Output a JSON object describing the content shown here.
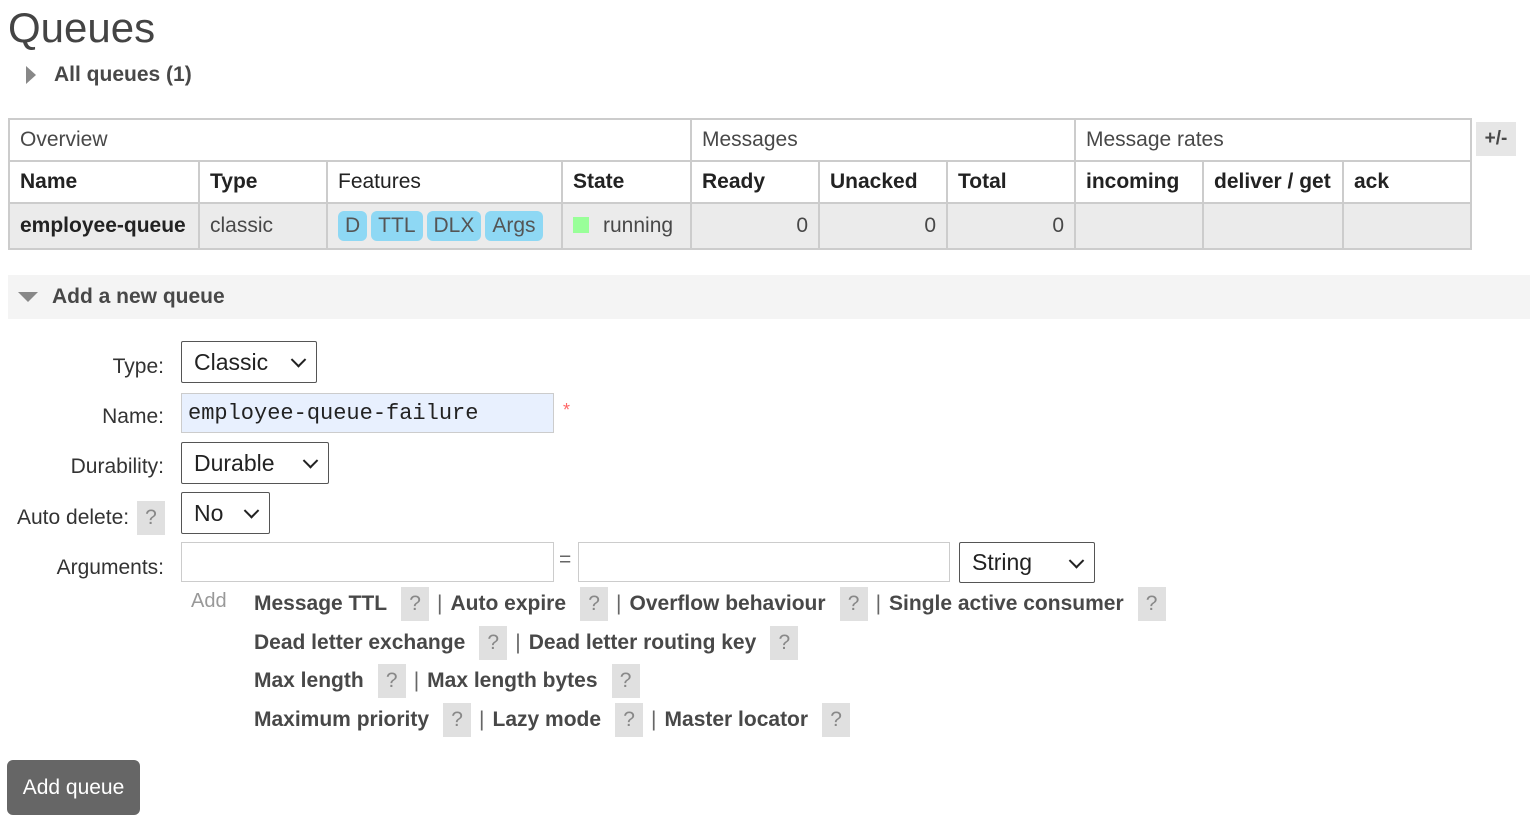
{
  "page": {
    "title": "Queues"
  },
  "all_queues": {
    "label": "All queues (1)"
  },
  "table": {
    "groups": [
      "Overview",
      "Messages",
      "Message rates"
    ],
    "plus_minus": "+/-",
    "headers": [
      "Name",
      "Type",
      "Features",
      "State",
      "Ready",
      "Unacked",
      "Total",
      "incoming",
      "deliver / get",
      "ack"
    ],
    "rows": [
      {
        "name": "employee-queue",
        "type": "classic",
        "features": [
          "D",
          "TTL",
          "DLX",
          "Args"
        ],
        "state": "running",
        "ready": "0",
        "unacked": "0",
        "total": "0",
        "incoming": "",
        "deliver_get": "",
        "ack": ""
      }
    ]
  },
  "add_queue": {
    "section_label": "Add a new queue",
    "type_label": "Type:",
    "type_value": "Classic",
    "name_label": "Name:",
    "name_value": "employee-queue-failure",
    "required_mark": "*",
    "durability_label": "Durability:",
    "durability_value": "Durable",
    "auto_delete_label": "Auto delete:",
    "auto_delete_value": "No",
    "arguments_label": "Arguments:",
    "equals": "=",
    "arg_type_value": "String",
    "add_label": "Add",
    "help_glyph": "?",
    "separator": "|",
    "arg_links": [
      [
        "Message TTL",
        "Auto expire",
        "Overflow behaviour",
        "Single active consumer"
      ],
      [
        "Dead letter exchange",
        "Dead letter routing key"
      ],
      [
        "Max length",
        "Max length bytes"
      ],
      [
        "Maximum priority",
        "Lazy mode",
        "Master locator"
      ]
    ],
    "submit_label": "Add queue"
  },
  "colors": {
    "badge": "#8ed8f4",
    "state_running": "#99ff99",
    "button": "#666666",
    "name_input_bg": "#e8f0fe"
  },
  "icons": {
    "collapsed": "triangle-right-icon",
    "expanded": "triangle-down-icon",
    "select": "chevron-down-icon"
  }
}
